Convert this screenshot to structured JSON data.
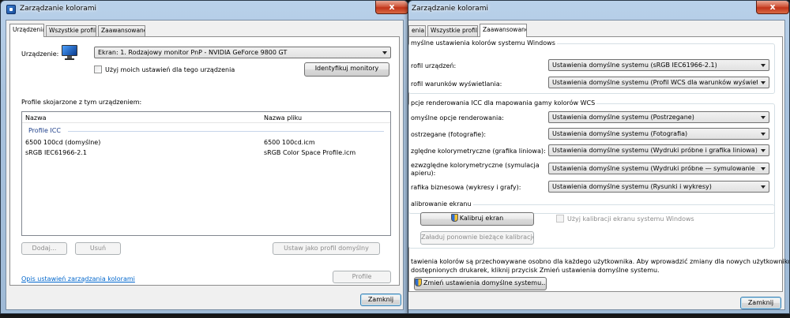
{
  "left_window": {
    "title": "Zarządzanie kolorami",
    "close_label": "x",
    "tabs": [
      {
        "label": "Urządzenia"
      },
      {
        "label": "Wszystkie profile"
      },
      {
        "label": "Zaawansowane"
      }
    ],
    "device_label": "Urządzenie:",
    "device_value": "Ekran: 1. Rodzajowy monitor PnP - NVIDIA GeForce 9800 GT",
    "use_my_settings_label": "Użyj moich ustawień dla tego urządzenia",
    "identify_button": "Identyfikuj monitory",
    "profiles_label": "Profile skojarzone z tym urządzeniem:",
    "columns": [
      "Nazwa",
      "Nazwa pliku"
    ],
    "group_header": "Profile ICC",
    "rows": [
      {
        "name": "6500 100cd (domyślne)",
        "file": "6500 100cd.icm"
      },
      {
        "name": "sRGB IEC61966-2.1",
        "file": "sRGB Color Space Profile.icm"
      }
    ],
    "add_button": "Dodaj...",
    "remove_button": "Usuń",
    "set_default_button": "Ustaw jako profil domyślny",
    "help_link": "Opis ustawień zarządzania kolorami",
    "profile_button": "Profile",
    "close_button": "Zamknij"
  },
  "right_window": {
    "title": "Zarządzanie kolorami",
    "close_label": "x",
    "tabs": [
      {
        "label": "enia"
      },
      {
        "label": "Wszystkie profile"
      },
      {
        "label": "Zaawansowane"
      }
    ],
    "wcs_group_title": "myślne ustawienia kolorów systemu Windows",
    "device_profile_label": "rofil urządzeń:",
    "device_profile_value": "Ustawienia domyślne systemu (sRGB IEC61966-2.1)",
    "viewing_conditions_label": "rofil warunków wyświetlania:",
    "viewing_conditions_value": "Ustawienia domyślne systemu (Profil WCS dla warunków wyświetlania",
    "icc_group_title": "pcje renderowania ICC dla mapowania gamy kolorów WCS",
    "render_rows": [
      {
        "label": "omyślne opcje renderowania:",
        "value": "Ustawienia domyślne systemu (Postrzegane)"
      },
      {
        "label": "ostrzegane (fotografie):",
        "value": "Ustawienia domyślne systemu (Fotografia)"
      },
      {
        "label": "zględne kolorymetryczne (grafika liniowa):",
        "value": "Ustawienia domyślne systemu (Wydruki próbne i grafika liniowa)"
      },
      {
        "label": "ezwzględne kolorymetryczne (symulacja",
        "label2": "apieru):",
        "value": "Ustawienia domyślne systemu (Wydruki próbne — symulowanie koloru"
      },
      {
        "label": "rafika biznesowa (wykresy i grafy):",
        "value": "Ustawienia domyślne systemu (Rysunki i wykresy)"
      }
    ],
    "calibration_group_title": "alibrowanie ekranu",
    "calibrate_button": "Kalibruj ekran",
    "use_windows_calibration_label": "Użyj kalibracji ekranu systemu Windows",
    "reload_calibration_button": "Załaduj ponownie bieżące kalibracje",
    "info_line1": "tawienia kolorów są przechowywane osobno dla każdego użytkownika. Aby wprowadzić zmiany dla nowych użytkowników",
    "info_line2": "dostępnionych drukarek, kliknij przycisk Zmień ustawienia domyślne systemu.",
    "change_defaults_button": "Zmień ustawienia domyślne systemu...",
    "close_button": "Zamknij"
  },
  "colors": {
    "link": "#0066cc",
    "group_header": "#1e3f8a",
    "close_red": "#c1341a"
  }
}
